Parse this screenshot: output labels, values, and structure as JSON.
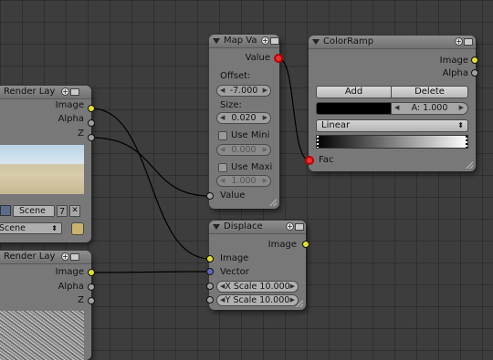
{
  "nodes": {
    "render_layers_top": {
      "title": "Render Lay",
      "outputs": {
        "image": "Image",
        "alpha": "Alpha",
        "z": "Z"
      },
      "scene": {
        "label": "Scene",
        "count": "7",
        "select": "Scene"
      }
    },
    "render_layers_bottom": {
      "title": "Render Lay",
      "outputs": {
        "image": "Image",
        "alpha": "Alpha",
        "z": "Z"
      }
    },
    "map_value": {
      "title": "Map Va",
      "output": "Value",
      "offset_label": "Offset:",
      "offset_value": "-7.000",
      "size_label": "Size:",
      "size_value": "0.020",
      "use_min_label": "Use Mini",
      "min_value": "0.000",
      "use_max_label": "Use Maxi",
      "max_value": "1.000",
      "input": "Value"
    },
    "color_ramp": {
      "title": "ColorRamp",
      "outputs": {
        "image": "Image",
        "alpha": "Alpha"
      },
      "add_label": "Add",
      "delete_label": "Delete",
      "alpha_field": "A: 1.000",
      "interpolation": "Linear",
      "input": "Fac"
    },
    "displace": {
      "title": "Displace",
      "output": "Image",
      "inputs": {
        "image": "Image",
        "vector": "Vector"
      },
      "x_scale": "X Scale 10.000",
      "y_scale": "Y Scale 10.000"
    }
  },
  "colors": {
    "background": "#3d3d3d",
    "node_body": "#787878",
    "socket_image": "#e0e032",
    "socket_value": "#a1a1a1",
    "socket_vector": "#6363c7",
    "socket_selected": "#e83030",
    "wire": "#000000"
  }
}
